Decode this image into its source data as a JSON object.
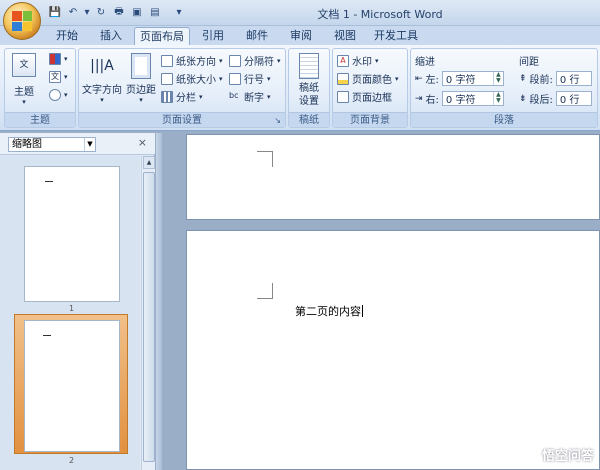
{
  "window": {
    "title": "文档 1 - Microsoft Word"
  },
  "tabs": [
    {
      "label": "开始"
    },
    {
      "label": "插入"
    },
    {
      "label": "页面布局",
      "active": true
    },
    {
      "label": "引用"
    },
    {
      "label": "邮件"
    },
    {
      "label": "审阅"
    },
    {
      "label": "视图"
    },
    {
      "label": "开发工具"
    }
  ],
  "ribbon": {
    "theme_group": {
      "label": "主题",
      "theme_button": "主题"
    },
    "page_setup": {
      "label": "页面设置",
      "text_direction": "文字方向",
      "margins": "页边距",
      "orientation": "纸张方向",
      "size": "纸张大小",
      "columns": "分栏",
      "breaks": "分隔符",
      "line_numbers": "行号",
      "hyphenation": "断字"
    },
    "draft_paper": {
      "label": "稿纸",
      "button": "稿纸\n设置"
    },
    "page_background": {
      "label": "页面背景",
      "watermark": "水印",
      "page_color": "页面颜色",
      "page_borders": "页面边框"
    },
    "paragraph": {
      "label": "段落",
      "indent_title": "缩进",
      "spacing_title": "间距",
      "left_label": "左:",
      "right_label": "右:",
      "left_value": "0 字符",
      "right_value": "0 字符",
      "before_label": "段前:",
      "after_label": "段后:",
      "before_value": "0 行",
      "after_value": "0 行"
    }
  },
  "nav_pane": {
    "view_select": "缩略图",
    "close": "×",
    "thumbnails": [
      {
        "page": "1"
      },
      {
        "page": "2"
      }
    ]
  },
  "document": {
    "page2_text": "第二页的内容"
  },
  "watermark": {
    "text": "悟空问答"
  }
}
